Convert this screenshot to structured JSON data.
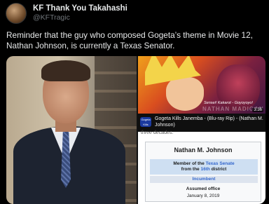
{
  "tweet": {
    "display_name": "KF Thank You Takahashi",
    "handle": "@KFTragic",
    "text": "Reminder that the guy who composed Gogeta’s theme in Movie 12, Nathan Johnson, is currently a Texas Senator."
  },
  "video": {
    "subtitle": "Sensei! Kakarot - Goyoyoyo!",
    "watermark": "NATHAN MADIGAN",
    "duration": "3:36",
    "mini_thumb_text": "Gogeta Kills",
    "title": "Gogeta Kills Janemba - (Blu-ray Rip) - (Nathan M. Johnson)"
  },
  "wiki": {
    "snippet": "three decades.",
    "name": "Nathan M. Johnson",
    "member_prefix": "Member of the",
    "member_link": "Texas Senate",
    "member_from": "from the",
    "district_link": "16th",
    "district_suffix": "district",
    "incumbent": "Incumbent",
    "assumed_label": "Assumed office",
    "assumed_date": "January 8, 2019"
  }
}
